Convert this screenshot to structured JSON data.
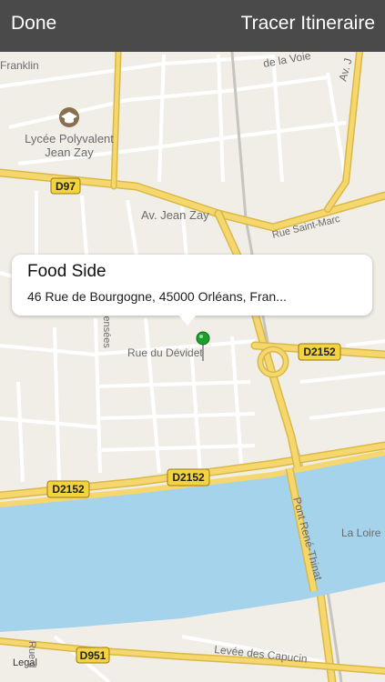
{
  "nav": {
    "done_label": "Done",
    "route_label": "Tracer Itineraire"
  },
  "callout": {
    "title": "Food Side",
    "address": "46 Rue de Bourgogne, 45000 Orléans, Fran..."
  },
  "map": {
    "labels": {
      "school": "Lycée Polyvalent\nJean Zay",
      "school_line1": "Lycée Polyvalent",
      "school_line2": "Jean Zay",
      "franklin": "Franklin",
      "voie": "de la Voie",
      "av_top_right": "Av. J",
      "jean_zay": "Av. Jean Zay",
      "saint_marc": "Rue Saint-Marc",
      "devidet": "Rue du Dévidet",
      "pensees": "Pensées",
      "pont": "Pont René-Thinat",
      "loire": "La Loire",
      "levee": "Levée des Capucin",
      "rue_left": "Rue d",
      "legal": "Legal"
    },
    "shields": {
      "d97": "D97",
      "d2152_right": "D2152",
      "d2152_mid": "D2152",
      "d2152_left": "D2152",
      "d951": "D951"
    },
    "colors": {
      "land": "#f1eee7",
      "water": "#a5d3ec",
      "road_yellow": "#f5d76e",
      "pin": "#1e9e2a"
    }
  }
}
